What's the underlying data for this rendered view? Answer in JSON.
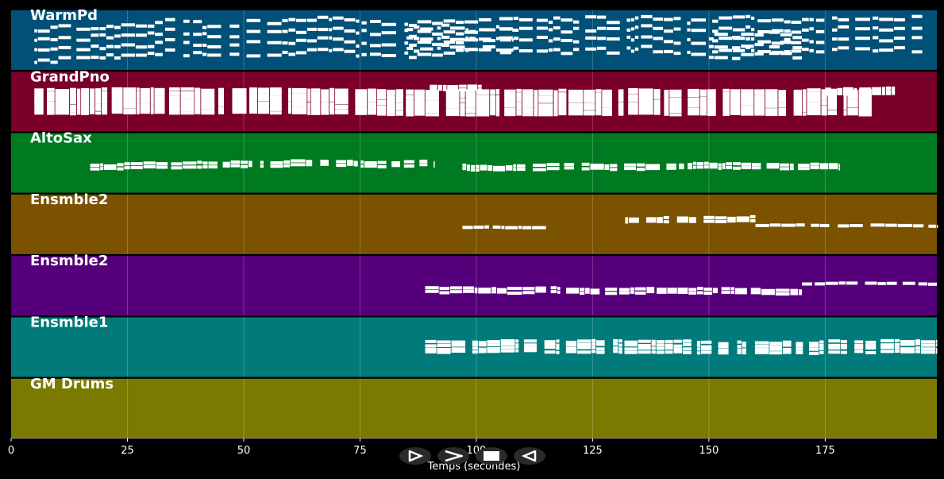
{
  "x_axis": {
    "title": "Temps (secondes)",
    "range": [
      0,
      199
    ],
    "ticks": [
      0,
      25,
      50,
      75,
      100,
      125,
      150,
      175
    ]
  },
  "tracks": [
    {
      "name": "WarmPd",
      "color": "#005078",
      "pitch_range": [
        60,
        70
      ],
      "segments": [
        [
          5,
          196,
          64,
          4
        ],
        [
          85,
          108,
          65,
          3
        ],
        [
          150,
          170,
          63,
          3
        ]
      ]
    },
    {
      "name": "GrandPno",
      "color": "#7a0029",
      "pitch_range": [
        40,
        80
      ],
      "segments": [
        [
          5,
          185,
          60,
          10
        ],
        [
          90,
          102,
          72,
          2
        ],
        [
          175,
          190,
          68,
          3
        ]
      ]
    },
    {
      "name": "AltoSax",
      "color": "#007a20",
      "pitch_range": [
        50,
        80
      ],
      "segments": [
        [
          17,
          91,
          62,
          2
        ],
        [
          97,
          178,
          62,
          2
        ]
      ]
    },
    {
      "name": "Ensmble2",
      "color": "#7a5200",
      "pitch_range": [
        50,
        80
      ],
      "segments": [
        [
          97,
          115,
          63,
          1
        ],
        [
          132,
          160,
          68,
          2
        ],
        [
          160,
          199,
          64,
          1
        ]
      ]
    },
    {
      "name": "Ensmble2",
      "color": "#55007a",
      "pitch_range": [
        50,
        80
      ],
      "segments": [
        [
          89,
          170,
          62,
          2
        ],
        [
          170,
          199,
          66,
          1
        ]
      ]
    },
    {
      "name": "Ensmble1",
      "color": "#007a7a",
      "pitch_range": [
        50,
        80
      ],
      "segments": [
        [
          89,
          199,
          65,
          4
        ]
      ]
    },
    {
      "name": "GM Drums",
      "color": "#7a7a00",
      "pitch_range": [
        50,
        80
      ],
      "segments": []
    }
  ],
  "transport": {
    "play_label": "play",
    "next_label": "next",
    "stop_label": "stop",
    "prev_label": "previous"
  }
}
